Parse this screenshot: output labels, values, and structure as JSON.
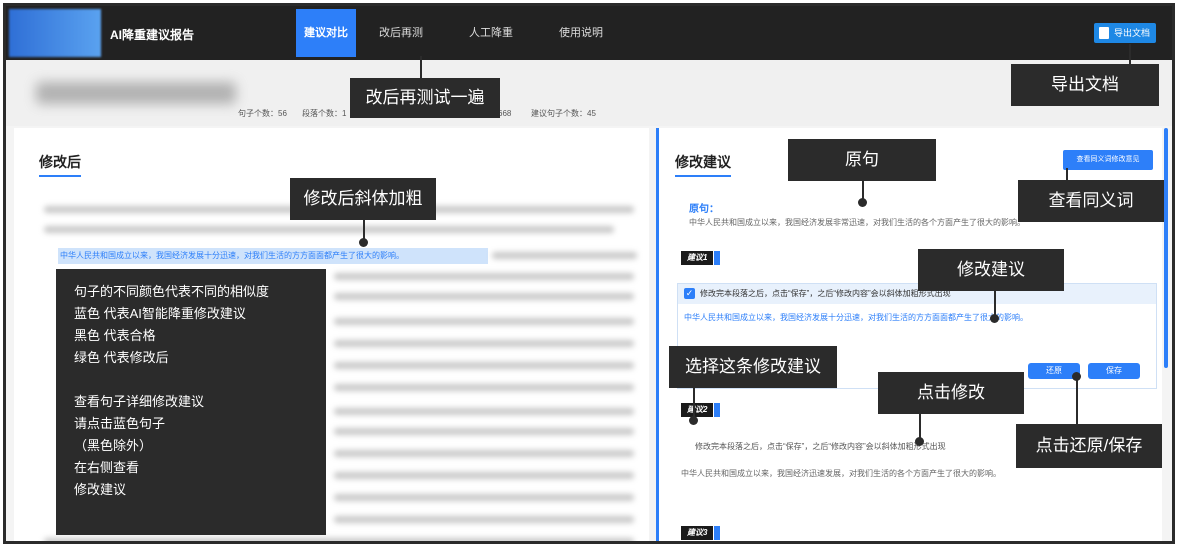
{
  "app": {
    "title": "AI降重建议报告"
  },
  "nav": [
    {
      "label": "建议对比",
      "active": true
    },
    {
      "label": "改后再测",
      "active": false
    },
    {
      "label": "人工降重",
      "active": false
    },
    {
      "label": "使用说明",
      "active": false
    }
  ],
  "header": {
    "export_label": "导出文档"
  },
  "stats": {
    "sentences": "句子个数：56",
    "paragraphs": "段落个数：1",
    "other": "：668",
    "suggested": "建议句子个数：45"
  },
  "left": {
    "title": "修改后",
    "highlight_sentence": "中华人民共和国成立以来，我国经济发展十分迅速，对我们生活的方方面面都产生了很大的影响。"
  },
  "right": {
    "title": "修改建议",
    "synonym_button": "查看同义词修改意见",
    "original_label": "原句：",
    "original_text": "中华人民共和国成立以来，我国经济发展非常迅速，对我们生活的各个方面产生了很大的影响。",
    "items": [
      {
        "tag": "建议1",
        "instruction": "修改完本段落之后，点击“保存”，之后“修改内容”会以斜体加粗形式出现",
        "text": "中华人民共和国成立以来，我国经济发展十分迅速，对我们生活的方方面面都产生了很大的影响。",
        "restore": "还原",
        "save": "保存"
      },
      {
        "tag": "建议2",
        "instruction": "修改完本段落之后，点击“保存”，之后“修改内容”会以斜体加粗形式出现",
        "text": "中华人民共和国成立以来，我国经济迅速发展，对我们生活的各个方面产生了很大的影响。"
      },
      {
        "tag": "建议3"
      }
    ]
  },
  "callouts": {
    "retest": "改后再测试一遍",
    "export": "导出文档",
    "original": "原句",
    "synonym": "查看同义词",
    "italic_bold": "修改后斜体加粗",
    "suggestion": "修改建议",
    "select": "选择这条修改建议",
    "click_modify": "点击修改",
    "restore_save": "点击还原/保存"
  },
  "legend": {
    "lines": [
      "句子的不同颜色代表不同的相似度",
      "蓝色 代表AI智能降重修改建议",
      "黑色 代表合格",
      "绿色 代表修改后"
    ],
    "lines2": [
      "查看句子详细修改建议",
      "请点击蓝色句子",
      "（黑色除外）",
      "在右侧查看",
      "修改建议"
    ]
  }
}
